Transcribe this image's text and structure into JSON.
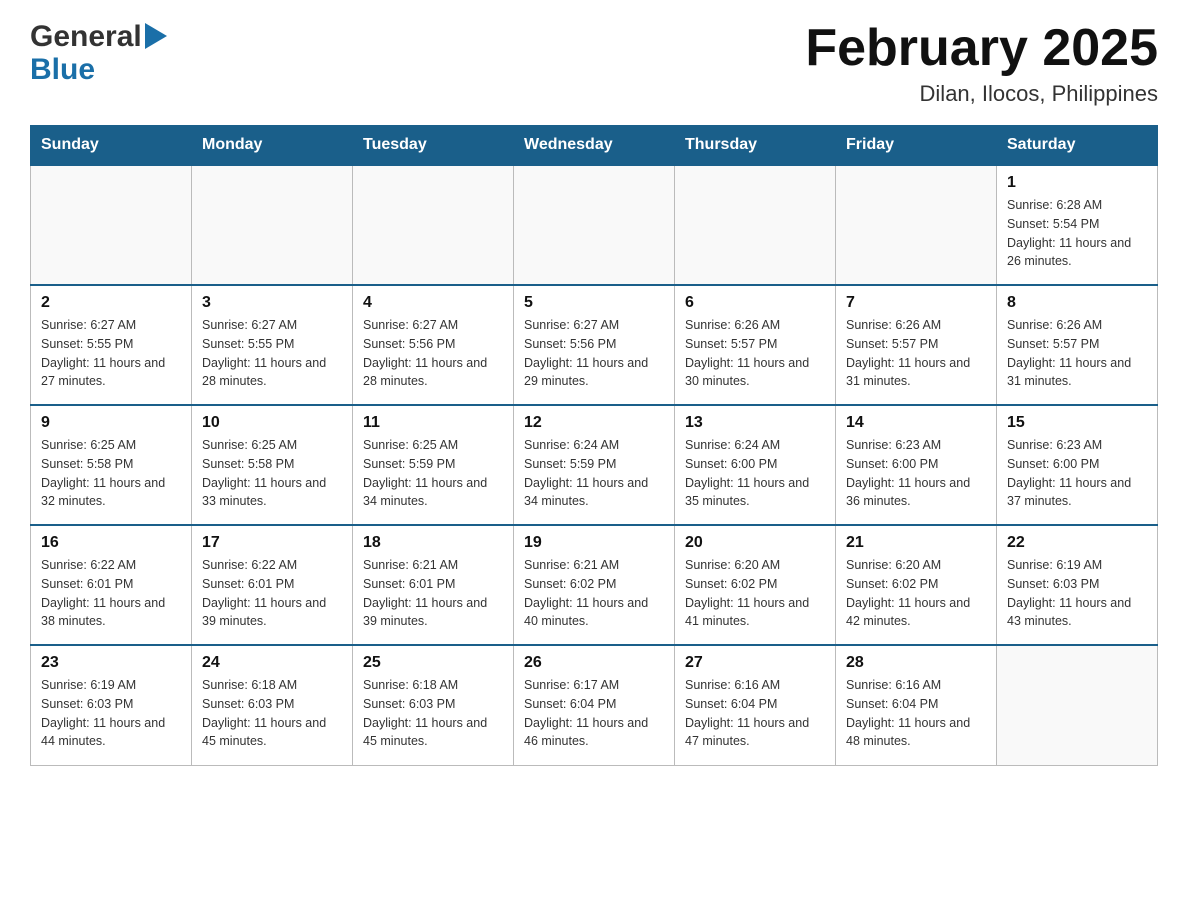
{
  "header": {
    "logo_general": "General",
    "logo_blue": "Blue",
    "title": "February 2025",
    "subtitle": "Dilan, Ilocos, Philippines"
  },
  "calendar": {
    "days_of_week": [
      "Sunday",
      "Monday",
      "Tuesday",
      "Wednesday",
      "Thursday",
      "Friday",
      "Saturday"
    ],
    "weeks": [
      [
        {
          "day": "",
          "info": ""
        },
        {
          "day": "",
          "info": ""
        },
        {
          "day": "",
          "info": ""
        },
        {
          "day": "",
          "info": ""
        },
        {
          "day": "",
          "info": ""
        },
        {
          "day": "",
          "info": ""
        },
        {
          "day": "1",
          "sunrise": "6:28 AM",
          "sunset": "5:54 PM",
          "daylight": "11 hours and 26 minutes."
        }
      ],
      [
        {
          "day": "2",
          "sunrise": "6:27 AM",
          "sunset": "5:55 PM",
          "daylight": "11 hours and 27 minutes."
        },
        {
          "day": "3",
          "sunrise": "6:27 AM",
          "sunset": "5:55 PM",
          "daylight": "11 hours and 28 minutes."
        },
        {
          "day": "4",
          "sunrise": "6:27 AM",
          "sunset": "5:56 PM",
          "daylight": "11 hours and 28 minutes."
        },
        {
          "day": "5",
          "sunrise": "6:27 AM",
          "sunset": "5:56 PM",
          "daylight": "11 hours and 29 minutes."
        },
        {
          "day": "6",
          "sunrise": "6:26 AM",
          "sunset": "5:57 PM",
          "daylight": "11 hours and 30 minutes."
        },
        {
          "day": "7",
          "sunrise": "6:26 AM",
          "sunset": "5:57 PM",
          "daylight": "11 hours and 31 minutes."
        },
        {
          "day": "8",
          "sunrise": "6:26 AM",
          "sunset": "5:57 PM",
          "daylight": "11 hours and 31 minutes."
        }
      ],
      [
        {
          "day": "9",
          "sunrise": "6:25 AM",
          "sunset": "5:58 PM",
          "daylight": "11 hours and 32 minutes."
        },
        {
          "day": "10",
          "sunrise": "6:25 AM",
          "sunset": "5:58 PM",
          "daylight": "11 hours and 33 minutes."
        },
        {
          "day": "11",
          "sunrise": "6:25 AM",
          "sunset": "5:59 PM",
          "daylight": "11 hours and 34 minutes."
        },
        {
          "day": "12",
          "sunrise": "6:24 AM",
          "sunset": "5:59 PM",
          "daylight": "11 hours and 34 minutes."
        },
        {
          "day": "13",
          "sunrise": "6:24 AM",
          "sunset": "6:00 PM",
          "daylight": "11 hours and 35 minutes."
        },
        {
          "day": "14",
          "sunrise": "6:23 AM",
          "sunset": "6:00 PM",
          "daylight": "11 hours and 36 minutes."
        },
        {
          "day": "15",
          "sunrise": "6:23 AM",
          "sunset": "6:00 PM",
          "daylight": "11 hours and 37 minutes."
        }
      ],
      [
        {
          "day": "16",
          "sunrise": "6:22 AM",
          "sunset": "6:01 PM",
          "daylight": "11 hours and 38 minutes."
        },
        {
          "day": "17",
          "sunrise": "6:22 AM",
          "sunset": "6:01 PM",
          "daylight": "11 hours and 39 minutes."
        },
        {
          "day": "18",
          "sunrise": "6:21 AM",
          "sunset": "6:01 PM",
          "daylight": "11 hours and 39 minutes."
        },
        {
          "day": "19",
          "sunrise": "6:21 AM",
          "sunset": "6:02 PM",
          "daylight": "11 hours and 40 minutes."
        },
        {
          "day": "20",
          "sunrise": "6:20 AM",
          "sunset": "6:02 PM",
          "daylight": "11 hours and 41 minutes."
        },
        {
          "day": "21",
          "sunrise": "6:20 AM",
          "sunset": "6:02 PM",
          "daylight": "11 hours and 42 minutes."
        },
        {
          "day": "22",
          "sunrise": "6:19 AM",
          "sunset": "6:03 PM",
          "daylight": "11 hours and 43 minutes."
        }
      ],
      [
        {
          "day": "23",
          "sunrise": "6:19 AM",
          "sunset": "6:03 PM",
          "daylight": "11 hours and 44 minutes."
        },
        {
          "day": "24",
          "sunrise": "6:18 AM",
          "sunset": "6:03 PM",
          "daylight": "11 hours and 45 minutes."
        },
        {
          "day": "25",
          "sunrise": "6:18 AM",
          "sunset": "6:03 PM",
          "daylight": "11 hours and 45 minutes."
        },
        {
          "day": "26",
          "sunrise": "6:17 AM",
          "sunset": "6:04 PM",
          "daylight": "11 hours and 46 minutes."
        },
        {
          "day": "27",
          "sunrise": "6:16 AM",
          "sunset": "6:04 PM",
          "daylight": "11 hours and 47 minutes."
        },
        {
          "day": "28",
          "sunrise": "6:16 AM",
          "sunset": "6:04 PM",
          "daylight": "11 hours and 48 minutes."
        },
        {
          "day": "",
          "info": ""
        }
      ]
    ]
  }
}
